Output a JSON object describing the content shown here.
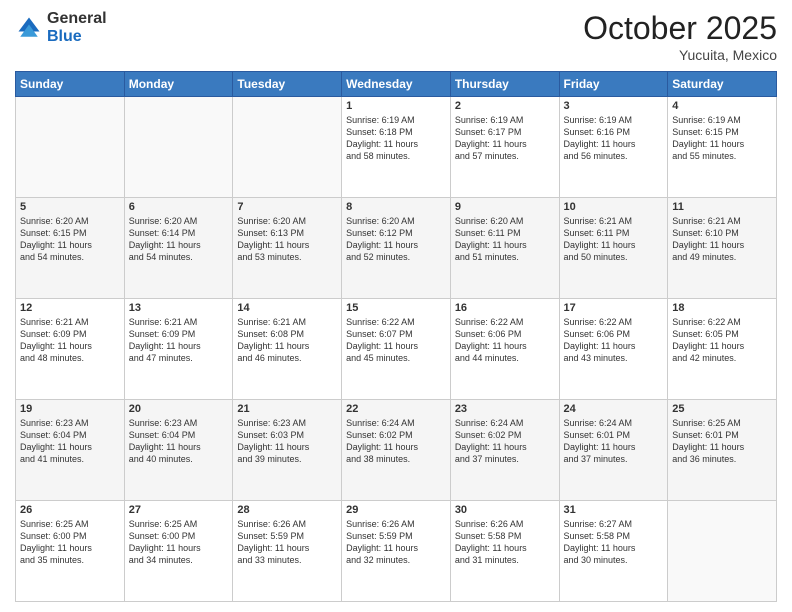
{
  "logo": {
    "general": "General",
    "blue": "Blue"
  },
  "header": {
    "month": "October 2025",
    "location": "Yucuita, Mexico"
  },
  "weekdays": [
    "Sunday",
    "Monday",
    "Tuesday",
    "Wednesday",
    "Thursday",
    "Friday",
    "Saturday"
  ],
  "weeks": [
    [
      {
        "day": "",
        "info": ""
      },
      {
        "day": "",
        "info": ""
      },
      {
        "day": "",
        "info": ""
      },
      {
        "day": "1",
        "info": "Sunrise: 6:19 AM\nSunset: 6:18 PM\nDaylight: 11 hours\nand 58 minutes."
      },
      {
        "day": "2",
        "info": "Sunrise: 6:19 AM\nSunset: 6:17 PM\nDaylight: 11 hours\nand 57 minutes."
      },
      {
        "day": "3",
        "info": "Sunrise: 6:19 AM\nSunset: 6:16 PM\nDaylight: 11 hours\nand 56 minutes."
      },
      {
        "day": "4",
        "info": "Sunrise: 6:19 AM\nSunset: 6:15 PM\nDaylight: 11 hours\nand 55 minutes."
      }
    ],
    [
      {
        "day": "5",
        "info": "Sunrise: 6:20 AM\nSunset: 6:15 PM\nDaylight: 11 hours\nand 54 minutes."
      },
      {
        "day": "6",
        "info": "Sunrise: 6:20 AM\nSunset: 6:14 PM\nDaylight: 11 hours\nand 54 minutes."
      },
      {
        "day": "7",
        "info": "Sunrise: 6:20 AM\nSunset: 6:13 PM\nDaylight: 11 hours\nand 53 minutes."
      },
      {
        "day": "8",
        "info": "Sunrise: 6:20 AM\nSunset: 6:12 PM\nDaylight: 11 hours\nand 52 minutes."
      },
      {
        "day": "9",
        "info": "Sunrise: 6:20 AM\nSunset: 6:11 PM\nDaylight: 11 hours\nand 51 minutes."
      },
      {
        "day": "10",
        "info": "Sunrise: 6:21 AM\nSunset: 6:11 PM\nDaylight: 11 hours\nand 50 minutes."
      },
      {
        "day": "11",
        "info": "Sunrise: 6:21 AM\nSunset: 6:10 PM\nDaylight: 11 hours\nand 49 minutes."
      }
    ],
    [
      {
        "day": "12",
        "info": "Sunrise: 6:21 AM\nSunset: 6:09 PM\nDaylight: 11 hours\nand 48 minutes."
      },
      {
        "day": "13",
        "info": "Sunrise: 6:21 AM\nSunset: 6:09 PM\nDaylight: 11 hours\nand 47 minutes."
      },
      {
        "day": "14",
        "info": "Sunrise: 6:21 AM\nSunset: 6:08 PM\nDaylight: 11 hours\nand 46 minutes."
      },
      {
        "day": "15",
        "info": "Sunrise: 6:22 AM\nSunset: 6:07 PM\nDaylight: 11 hours\nand 45 minutes."
      },
      {
        "day": "16",
        "info": "Sunrise: 6:22 AM\nSunset: 6:06 PM\nDaylight: 11 hours\nand 44 minutes."
      },
      {
        "day": "17",
        "info": "Sunrise: 6:22 AM\nSunset: 6:06 PM\nDaylight: 11 hours\nand 43 minutes."
      },
      {
        "day": "18",
        "info": "Sunrise: 6:22 AM\nSunset: 6:05 PM\nDaylight: 11 hours\nand 42 minutes."
      }
    ],
    [
      {
        "day": "19",
        "info": "Sunrise: 6:23 AM\nSunset: 6:04 PM\nDaylight: 11 hours\nand 41 minutes."
      },
      {
        "day": "20",
        "info": "Sunrise: 6:23 AM\nSunset: 6:04 PM\nDaylight: 11 hours\nand 40 minutes."
      },
      {
        "day": "21",
        "info": "Sunrise: 6:23 AM\nSunset: 6:03 PM\nDaylight: 11 hours\nand 39 minutes."
      },
      {
        "day": "22",
        "info": "Sunrise: 6:24 AM\nSunset: 6:02 PM\nDaylight: 11 hours\nand 38 minutes."
      },
      {
        "day": "23",
        "info": "Sunrise: 6:24 AM\nSunset: 6:02 PM\nDaylight: 11 hours\nand 37 minutes."
      },
      {
        "day": "24",
        "info": "Sunrise: 6:24 AM\nSunset: 6:01 PM\nDaylight: 11 hours\nand 37 minutes."
      },
      {
        "day": "25",
        "info": "Sunrise: 6:25 AM\nSunset: 6:01 PM\nDaylight: 11 hours\nand 36 minutes."
      }
    ],
    [
      {
        "day": "26",
        "info": "Sunrise: 6:25 AM\nSunset: 6:00 PM\nDaylight: 11 hours\nand 35 minutes."
      },
      {
        "day": "27",
        "info": "Sunrise: 6:25 AM\nSunset: 6:00 PM\nDaylight: 11 hours\nand 34 minutes."
      },
      {
        "day": "28",
        "info": "Sunrise: 6:26 AM\nSunset: 5:59 PM\nDaylight: 11 hours\nand 33 minutes."
      },
      {
        "day": "29",
        "info": "Sunrise: 6:26 AM\nSunset: 5:59 PM\nDaylight: 11 hours\nand 32 minutes."
      },
      {
        "day": "30",
        "info": "Sunrise: 6:26 AM\nSunset: 5:58 PM\nDaylight: 11 hours\nand 31 minutes."
      },
      {
        "day": "31",
        "info": "Sunrise: 6:27 AM\nSunset: 5:58 PM\nDaylight: 11 hours\nand 30 minutes."
      },
      {
        "day": "",
        "info": ""
      }
    ]
  ]
}
